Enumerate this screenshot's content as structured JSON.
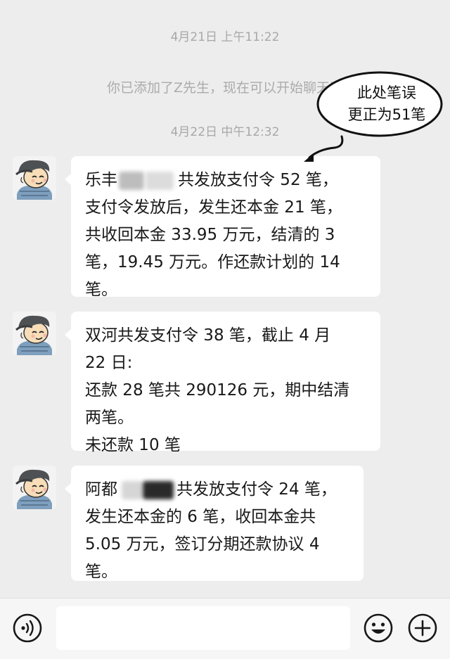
{
  "timestamps": [
    "4月21日 上午11:22",
    "4月22日 中午12:32"
  ],
  "system_message": "你已添加了Z先生，现在可以开始聊天了",
  "annotation": {
    "line1": "此处笔误",
    "line2": "更正为51笔"
  },
  "messages": [
    {
      "line1_prefix": "乐丰",
      "line1_suffix": "共发放支付令 52 笔，",
      "line2": "支付令发放后，发生还本金 21 笔，",
      "line3": "共收回本金 33.95 万元，结清的 3",
      "line4": "笔，19.45 万元。作还款计划的 14",
      "line5": "笔。"
    },
    {
      "line1": "双河共发支付令 38 笔，截止 4 月",
      "line2": "22 日:",
      "line3": "还款 28 笔共 290126 元，期中结清",
      "line4": "两笔。",
      "line5": "未还款 10 笔"
    },
    {
      "line1_prefix": "阿都",
      "line1_suffix": "共发放支付令 24 笔，",
      "line2": "发生还本金的 6 笔，收回本金共",
      "line3": "5.05 万元，签订分期还款协议 4",
      "line4": "笔。"
    }
  ],
  "icons": {
    "voice": "voice-icon",
    "emoji": "emoji-icon",
    "plus": "plus-icon",
    "avatar": "cartoon-avatar"
  },
  "colors": {
    "background": "#ededed",
    "bubble": "#ffffff",
    "timestamp": "#a8a8a8"
  }
}
